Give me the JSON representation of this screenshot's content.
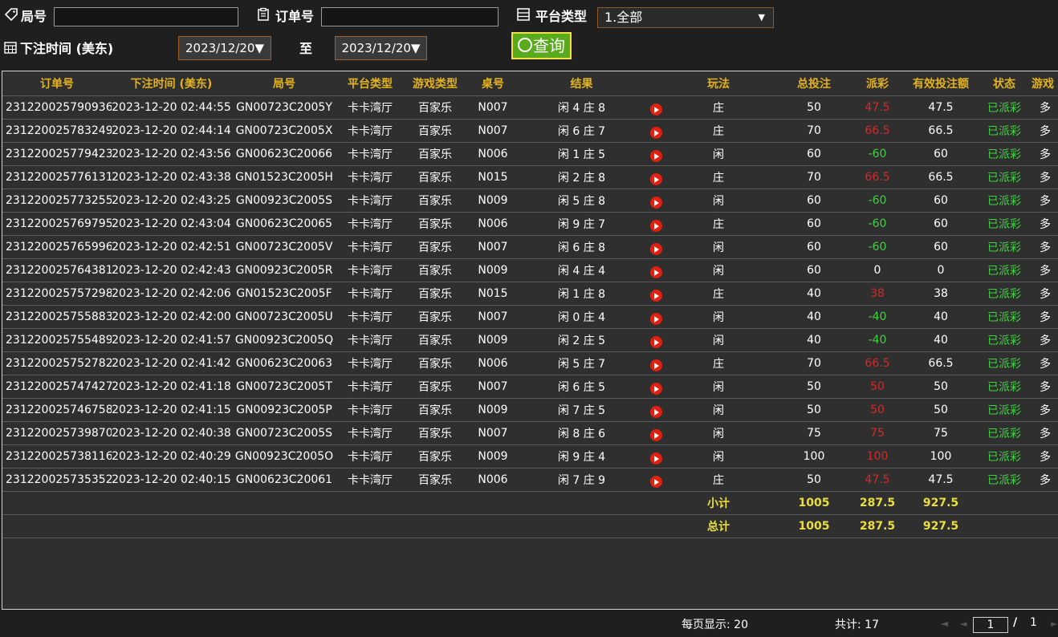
{
  "filters": {
    "ju_label": "局号",
    "order_label": "订单号",
    "platform_label": "平台类型",
    "platform_value": "1.全部",
    "time_label": "下注时间 (美东)",
    "date_from": "2023/12/20▼",
    "to_label": "至",
    "date_to": "2023/12/20▼",
    "query_label": "查询"
  },
  "table": {
    "headers": [
      "订单号",
      "下注时间 (美东)",
      "局号",
      "平台类型",
      "游戏类型",
      "桌号",
      "结果",
      "",
      "玩法",
      "总投注",
      "派彩",
      "有效投注额",
      "状态",
      "游戏"
    ],
    "rows": [
      [
        "231220025790936",
        "2023-12-20 02:44:55",
        "GN00723C2005Y",
        "卡卡湾厅",
        "百家乐",
        "N007",
        "闲 4 庄 8",
        "庄",
        "50",
        "47.5",
        "47.5",
        "已派彩",
        "多"
      ],
      [
        "231220025783249",
        "2023-12-20 02:44:14",
        "GN00723C2005X",
        "卡卡湾厅",
        "百家乐",
        "N007",
        "闲 6 庄 7",
        "庄",
        "70",
        "66.5",
        "66.5",
        "已派彩",
        "多"
      ],
      [
        "231220025779423",
        "2023-12-20 02:43:56",
        "GN00623C20066",
        "卡卡湾厅",
        "百家乐",
        "N006",
        "闲 1 庄 5",
        "闲",
        "60",
        "-60",
        "60",
        "已派彩",
        "多"
      ],
      [
        "231220025776131",
        "2023-12-20 02:43:38",
        "GN01523C2005H",
        "卡卡湾厅",
        "百家乐",
        "N015",
        "闲 2 庄 8",
        "庄",
        "70",
        "66.5",
        "66.5",
        "已派彩",
        "多"
      ],
      [
        "231220025773255",
        "2023-12-20 02:43:25",
        "GN00923C2005S",
        "卡卡湾厅",
        "百家乐",
        "N009",
        "闲 5 庄 8",
        "闲",
        "60",
        "-60",
        "60",
        "已派彩",
        "多"
      ],
      [
        "231220025769795",
        "2023-12-20 02:43:04",
        "GN00623C20065",
        "卡卡湾厅",
        "百家乐",
        "N006",
        "闲 9 庄 7",
        "庄",
        "60",
        "-60",
        "60",
        "已派彩",
        "多"
      ],
      [
        "231220025765996",
        "2023-12-20 02:42:51",
        "GN00723C2005V",
        "卡卡湾厅",
        "百家乐",
        "N007",
        "闲 6 庄 8",
        "闲",
        "60",
        "-60",
        "60",
        "已派彩",
        "多"
      ],
      [
        "231220025764381",
        "2023-12-20 02:42:43",
        "GN00923C2005R",
        "卡卡湾厅",
        "百家乐",
        "N009",
        "闲 4 庄 4",
        "闲",
        "60",
        "0",
        "0",
        "已派彩",
        "多"
      ],
      [
        "231220025757298",
        "2023-12-20 02:42:06",
        "GN01523C2005F",
        "卡卡湾厅",
        "百家乐",
        "N015",
        "闲 1 庄 8",
        "庄",
        "40",
        "38",
        "38",
        "已派彩",
        "多"
      ],
      [
        "231220025755883",
        "2023-12-20 02:42:00",
        "GN00723C2005U",
        "卡卡湾厅",
        "百家乐",
        "N007",
        "闲 0 庄 4",
        "闲",
        "40",
        "-40",
        "40",
        "已派彩",
        "多"
      ],
      [
        "231220025755489",
        "2023-12-20 02:41:57",
        "GN00923C2005Q",
        "卡卡湾厅",
        "百家乐",
        "N009",
        "闲 2 庄 5",
        "闲",
        "40",
        "-40",
        "40",
        "已派彩",
        "多"
      ],
      [
        "231220025752782",
        "2023-12-20 02:41:42",
        "GN00623C20063",
        "卡卡湾厅",
        "百家乐",
        "N006",
        "闲 5 庄 7",
        "庄",
        "70",
        "66.5",
        "66.5",
        "已派彩",
        "多"
      ],
      [
        "231220025747427",
        "2023-12-20 02:41:18",
        "GN00723C2005T",
        "卡卡湾厅",
        "百家乐",
        "N007",
        "闲 6 庄 5",
        "闲",
        "50",
        "50",
        "50",
        "已派彩",
        "多"
      ],
      [
        "231220025746758",
        "2023-12-20 02:41:15",
        "GN00923C2005P",
        "卡卡湾厅",
        "百家乐",
        "N009",
        "闲 7 庄 5",
        "闲",
        "50",
        "50",
        "50",
        "已派彩",
        "多"
      ],
      [
        "231220025739870",
        "2023-12-20 02:40:38",
        "GN00723C2005S",
        "卡卡湾厅",
        "百家乐",
        "N007",
        "闲 8 庄 6",
        "闲",
        "75",
        "75",
        "75",
        "已派彩",
        "多"
      ],
      [
        "231220025738116",
        "2023-12-20 02:40:29",
        "GN00923C2005O",
        "卡卡湾厅",
        "百家乐",
        "N009",
        "闲 9 庄 4",
        "闲",
        "100",
        "100",
        "100",
        "已派彩",
        "多"
      ],
      [
        "231220025735352",
        "2023-12-20 02:40:15",
        "GN00623C20061",
        "卡卡湾厅",
        "百家乐",
        "N006",
        "闲 7 庄 9",
        "庄",
        "50",
        "47.5",
        "47.5",
        "已派彩",
        "多"
      ]
    ],
    "subtotal": {
      "label": "小计",
      "bet": "1005",
      "payout": "287.5",
      "valid": "927.5"
    },
    "total": {
      "label": "总计",
      "bet": "1005",
      "payout": "287.5",
      "valid": "927.5"
    }
  },
  "footer": {
    "per_page": "每页显示: 20",
    "total_count": "共计: 17",
    "page_current": "1",
    "page_sep": "/",
    "page_total": "1"
  },
  "colors": {
    "header_text": "#e3b21f",
    "payout_win": "#d42a2a",
    "payout_loss": "#3fd23f",
    "status_paid": "#3fd23f",
    "total_text": "#ecdf3c",
    "query_button": "#5aaa1e"
  },
  "icons": {
    "ju": "tag-icon",
    "order": "clipboard-icon",
    "platform": "list-icon",
    "time": "calendar-icon",
    "query": "search-icon",
    "result": "play-icon"
  }
}
